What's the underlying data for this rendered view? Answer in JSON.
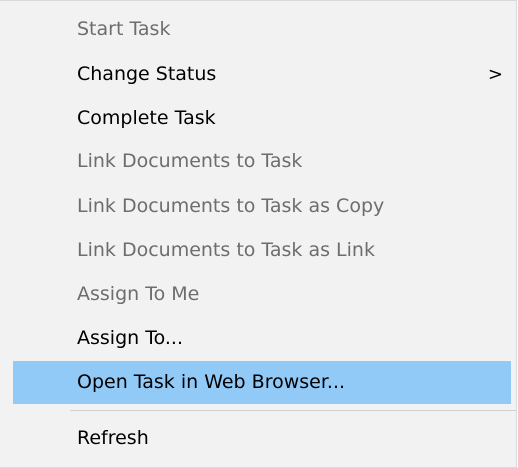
{
  "context_menu": {
    "items": [
      {
        "label": "Start Task",
        "enabled": false
      },
      {
        "label": "Change Status",
        "enabled": true,
        "submenu_indicator": ">"
      },
      {
        "label": "Complete Task",
        "enabled": true
      },
      {
        "label": "Link Documents to Task",
        "enabled": false
      },
      {
        "label": "Link Documents to Task as Copy",
        "enabled": false
      },
      {
        "label": "Link Documents to Task as Link",
        "enabled": false
      },
      {
        "label": "Assign To Me",
        "enabled": false
      },
      {
        "label": "Assign To...",
        "enabled": true
      },
      {
        "label": "Open Task in Web Browser...",
        "enabled": true,
        "highlighted": true
      },
      {
        "label": "Refresh",
        "enabled": true
      }
    ],
    "colors": {
      "background": "#f2f2f2",
      "highlight": "#91c9f7",
      "enabled_text": "#000000",
      "disabled_text": "#6d6d6d",
      "separator": "#d0d0d0"
    }
  }
}
